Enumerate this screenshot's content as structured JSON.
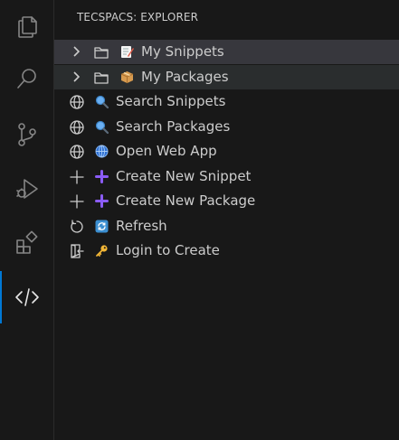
{
  "activity_bar": {
    "items": [
      {
        "name": "explorer",
        "icon": "files-icon",
        "active": false
      },
      {
        "name": "search",
        "icon": "search-icon",
        "active": false
      },
      {
        "name": "source-control",
        "icon": "source-control-icon",
        "active": false
      },
      {
        "name": "run-debug",
        "icon": "run-debug-icon",
        "active": false
      },
      {
        "name": "extensions",
        "icon": "extensions-icon",
        "active": false
      },
      {
        "name": "tecspacs",
        "icon": "code-icon",
        "active": true
      }
    ]
  },
  "sidebar": {
    "title": "TECSPACS: EXPLORER",
    "tree": [
      {
        "label": "My Snippets",
        "lead_icon": "folder-icon",
        "emoji_icon": "memo-icon",
        "expandable": true
      },
      {
        "label": "My Packages",
        "lead_icon": "folder-icon",
        "emoji_icon": "package-icon",
        "expandable": true
      }
    ],
    "actions": [
      {
        "label": "Search Snippets",
        "lead_icon": "globe-icon",
        "emoji_icon": "magnifier-icon"
      },
      {
        "label": "Search Packages",
        "lead_icon": "globe-icon",
        "emoji_icon": "magnifier-icon"
      },
      {
        "label": "Open Web App",
        "lead_icon": "globe-icon",
        "emoji_icon": "globe-emoji-icon"
      },
      {
        "label": "Create New Snippet",
        "lead_icon": "plus-icon",
        "emoji_icon": "purple-plus-icon"
      },
      {
        "label": "Create New Package",
        "lead_icon": "plus-icon",
        "emoji_icon": "purple-plus-icon"
      },
      {
        "label": "Refresh",
        "lead_icon": "refresh-icon",
        "emoji_icon": "refresh-emoji-icon"
      },
      {
        "label": "Login to Create",
        "lead_icon": "sign-in-icon",
        "emoji_icon": "key-icon"
      }
    ]
  },
  "colors": {
    "background": "#181818",
    "hover_row": "#2a2d2e",
    "selected_row": "#37373d",
    "accent": "#0078d4",
    "text": "#cccccc",
    "purple_plus": "#8b5cf6"
  }
}
